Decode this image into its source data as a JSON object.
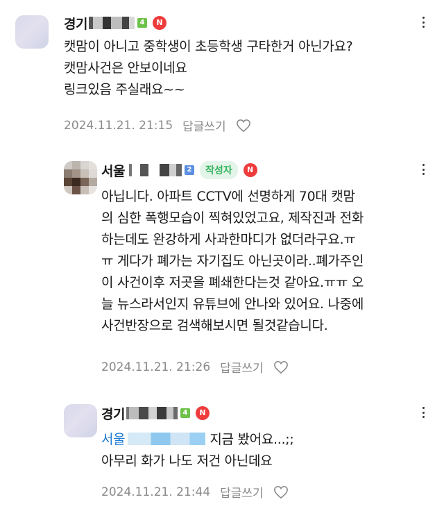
{
  "comments": [
    {
      "region": "경기",
      "level": "4",
      "badge": "N",
      "lines": [
        "캣맘이 아니고 중학생이 초등학생 구타한거 아닌가요?",
        "캣맘사건은 안보이네요",
        "링크있음 주실래요~~"
      ],
      "date": "2024.11.21. 21:15",
      "reply_label": "답글쓰기"
    },
    {
      "region": "서울",
      "level": "2",
      "author_label": "작성자",
      "badge": "N",
      "lines": [
        "아닙니다. 아파트 CCTV에 선명하게 70대 캣맘",
        "의 심한 폭행모습이 찍혀있었고요, 제작진과 전화",
        "하는데도 완강하게 사과한마디가 없더라구요.ㅠ",
        "ㅠ 게다가 폐가는 자기집도 아닌곳이라..폐가주인",
        "이 사건이후 저곳을 폐쇄한다는것 같아요.ㅠㅠ 오",
        "늘 뉴스라서인지 유튜브에 안나와 있어요. 나중에",
        "사건반장으로 검색해보시면 될것같습니다."
      ],
      "date": "2024.11.21. 21:26",
      "reply_label": "답글쓰기"
    },
    {
      "region": "경기",
      "level": "4",
      "badge": "N",
      "mention": "서울",
      "lines": [
        "지금 봤어요...;;",
        "아무리 화가 나도 저건 아닌데요"
      ],
      "date": "2024.11.21. 21:44",
      "reply_label": "답글쓰기"
    }
  ]
}
